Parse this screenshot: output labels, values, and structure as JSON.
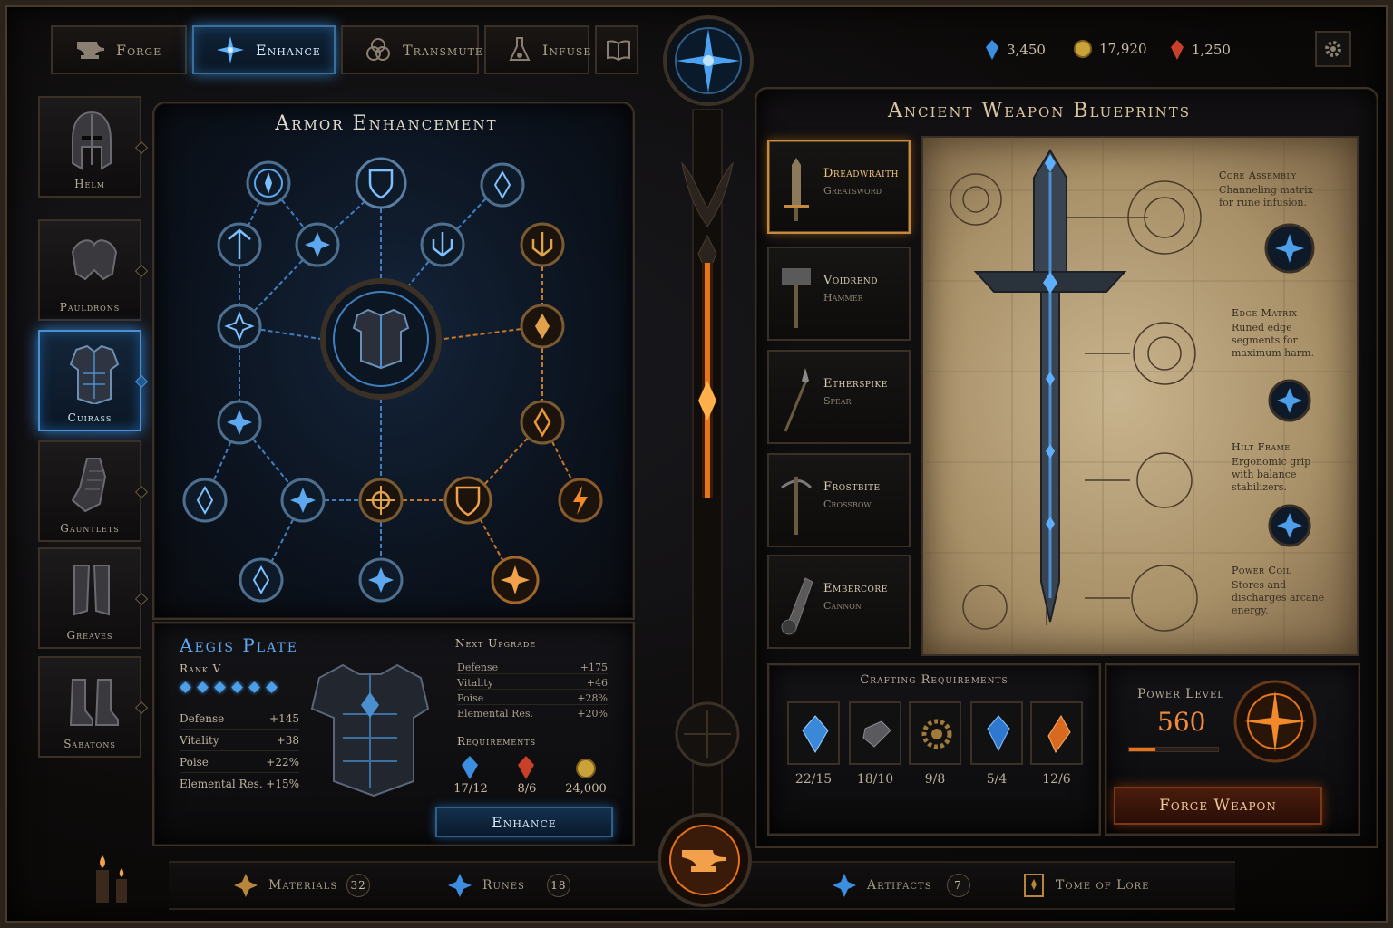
{
  "tabs": [
    {
      "label": "Forge",
      "icon": "anvil-icon"
    },
    {
      "label": "Enhance",
      "icon": "compass-star-icon",
      "active": true
    },
    {
      "label": "Transmute",
      "icon": "triquetra-icon"
    },
    {
      "label": "Infuse",
      "icon": "flask-icon"
    },
    {
      "label": "",
      "icon": "book-icon"
    }
  ],
  "currencies": [
    {
      "value": "3,450",
      "icon": "blue-crystal-icon",
      "color": "#3c8fe0"
    },
    {
      "value": "17,920",
      "icon": "gold-coin-icon",
      "color": "#c9a23a"
    },
    {
      "value": "1,250",
      "icon": "red-crystal-icon",
      "color": "#c8402a"
    }
  ],
  "settings_icon": "gear-icon",
  "armor": {
    "title": "Armor Enhancement",
    "slots": [
      {
        "label": "Helm"
      },
      {
        "label": "Pauldrons"
      },
      {
        "label": "Cuirass",
        "selected": true
      },
      {
        "label": "Gauntlets"
      },
      {
        "label": "Greaves"
      },
      {
        "label": "Sabatons"
      }
    ],
    "item": {
      "name": "Aegis Plate",
      "rank": "Rank V",
      "rank_pips": 6,
      "stats": [
        {
          "name": "Defense",
          "value": "+145"
        },
        {
          "name": "Vitality",
          "value": "+38"
        },
        {
          "name": "Poise",
          "value": "+22%"
        },
        {
          "name": "Elemental Res.",
          "value": "+15%"
        }
      ]
    },
    "next_upgrade": {
      "title": "Next Upgrade",
      "stats": [
        {
          "name": "Defense",
          "value": "+175"
        },
        {
          "name": "Vitality",
          "value": "+46"
        },
        {
          "name": "Poise",
          "value": "+28%"
        },
        {
          "name": "Elemental Res.",
          "value": "+20%"
        }
      ]
    },
    "requirements": {
      "title": "Requirements",
      "items": [
        {
          "icon": "blue-crystal-icon",
          "value": "17/12"
        },
        {
          "icon": "red-crystal-icon",
          "value": "8/6"
        },
        {
          "icon": "gold-coin-icon",
          "value": "24,000"
        }
      ]
    },
    "enhance_label": "Enhance"
  },
  "blueprints": {
    "title": "Ancient Weapon Blueprints",
    "weapons": [
      {
        "name": "Dreadwraith",
        "type": "Greatsword",
        "selected": true
      },
      {
        "name": "Voidrend",
        "type": "Hammer"
      },
      {
        "name": "Etherspike",
        "type": "Spear"
      },
      {
        "name": "Frostbite",
        "type": "Crossbow"
      },
      {
        "name": "Embercore",
        "type": "Cannon"
      }
    ],
    "notes": [
      {
        "title": "Core Assembly",
        "text": "Channeling matrix for rune infusion."
      },
      {
        "title": "Edge Matrix",
        "text": "Runed edge segments for maximum harm."
      },
      {
        "title": "Hilt Frame",
        "text": "Ergonomic grip with balance stabilizers."
      },
      {
        "title": "Power Coil",
        "text": "Stores and discharges arcane energy."
      }
    ],
    "crafting": {
      "title": "Crafting Requirements",
      "items": [
        {
          "icon": "blue-shard-icon",
          "value": "22/15"
        },
        {
          "icon": "iron-ingot-icon",
          "value": "18/10"
        },
        {
          "icon": "cog-icon",
          "value": "9/8"
        },
        {
          "icon": "blue-gem-icon",
          "value": "5/4"
        },
        {
          "icon": "fire-shard-icon",
          "value": "12/6"
        }
      ]
    },
    "power": {
      "label": "Power Level",
      "value": "560",
      "fill": 0.3
    },
    "forge_label": "Forge Weapon"
  },
  "bottom": [
    {
      "label": "Materials",
      "count": "32",
      "icon": "materials-icon"
    },
    {
      "label": "Runes",
      "count": "18",
      "icon": "rune-icon"
    },
    {
      "label": "Artifacts",
      "count": "7",
      "icon": "artifact-icon"
    },
    {
      "label": "Tome of Lore",
      "count": "",
      "icon": "tome-icon"
    }
  ]
}
